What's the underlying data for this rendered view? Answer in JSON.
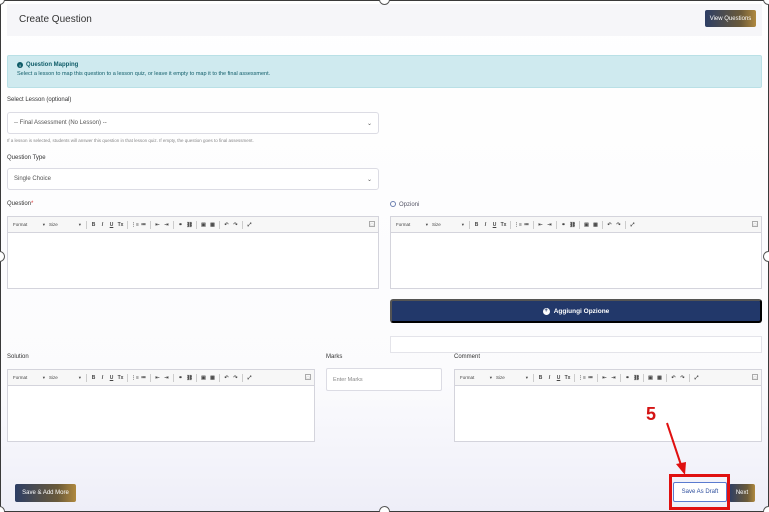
{
  "header": {
    "title": "Create Question",
    "view_questions_label": "View Questions"
  },
  "info": {
    "title": "Question Mapping",
    "description": "Select a lesson to map this question to a lesson quiz, or leave it empty to map it to the final assessment."
  },
  "lesson": {
    "label": "Select Lesson (optional)",
    "value": "-- Final Assessment (No Lesson) --",
    "help": "If a lesson is selected, students will answer this question in that lesson quiz. If empty, the question goes to final assessment."
  },
  "question_type": {
    "label": "Question Type",
    "value": "Single Choice"
  },
  "question": {
    "label": "Question",
    "required_mark": "*"
  },
  "options": {
    "label": "Opzioni",
    "add_button_label": "Aggiungi Opzione"
  },
  "toolbar": {
    "format": "Format",
    "size": "Size",
    "buttons": [
      "B",
      "I",
      "U",
      "Tx",
      "⋮≡",
      "≔",
      "⇤",
      "⇥",
      "⚭",
      "⛓",
      "▣",
      "▦",
      "↶",
      "↷",
      "⤢"
    ]
  },
  "solution": {
    "label": "Solution"
  },
  "marks": {
    "label": "Marks",
    "placeholder": "Enter Marks"
  },
  "comment": {
    "label": "Comment"
  },
  "footer": {
    "save_add_more_label": "Save & Add More",
    "save_draft_label": "Save As Draft",
    "next_label": "Next"
  },
  "annotation": {
    "step_number": "5"
  },
  "colors": {
    "primary_navy": "#22386a",
    "gold": "#b0893f",
    "info_bg": "#cfeaef",
    "annotation_red": "#e01010"
  }
}
